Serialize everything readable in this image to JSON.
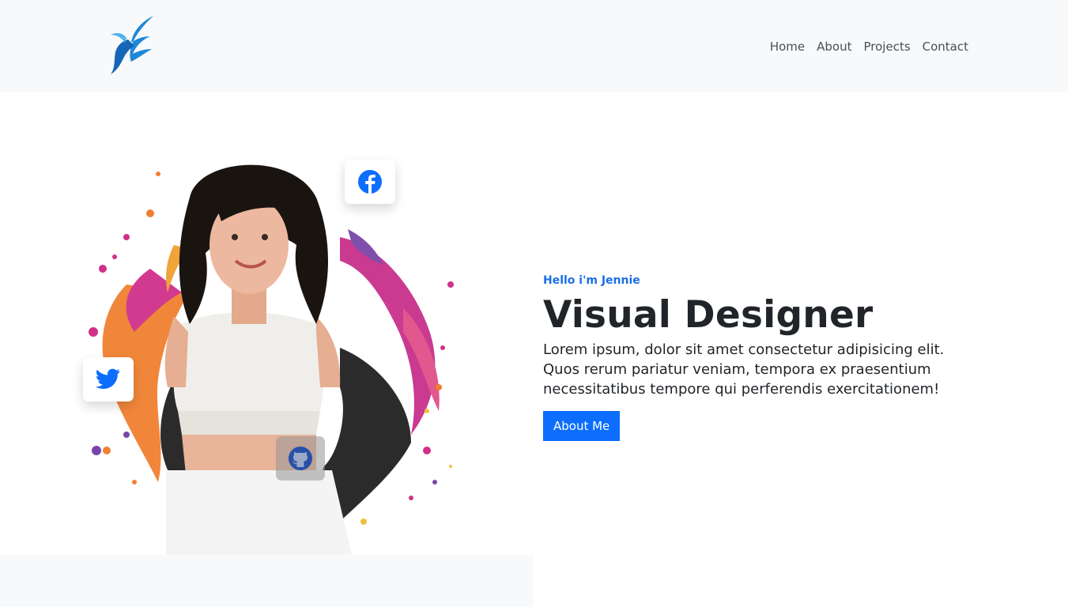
{
  "nav": {
    "logo_icon": "bird-wing-logo-icon",
    "links": [
      "Home",
      "About",
      "Projects",
      "Contact"
    ]
  },
  "hero": {
    "eyebrow": "Hello i'm Jennie",
    "title": "Visual Designer",
    "description": "Lorem ipsum, dolor sit amet consectetur adipisicing elit. Quos rerum pariatur veniam, tempora ex praesentium necessitatibus tempore qui perferendis exercitationem!",
    "button_label": "About Me",
    "portrait": "portrait-with-paint-splash-image"
  },
  "social": {
    "facebook_icon": "facebook-icon",
    "twitter_icon": "twitter-icon",
    "github_icon": "github-icon"
  },
  "colors": {
    "nav_bg": "#f8f9fa",
    "accent": "#0d6efd",
    "eyebrow": "#1a6fe8",
    "text": "#212529"
  }
}
